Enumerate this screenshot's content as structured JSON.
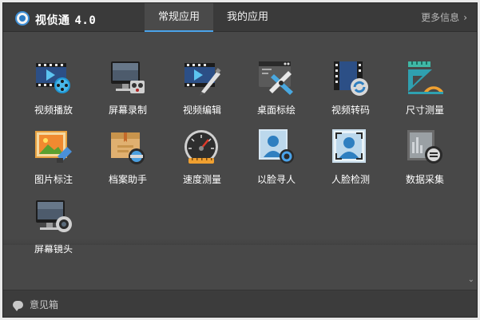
{
  "window": {
    "title": "视侦通",
    "version": "4.0"
  },
  "tabs": [
    {
      "label": "常规应用",
      "active": true
    },
    {
      "label": "我的应用",
      "active": false
    }
  ],
  "more": {
    "label": "更多信息",
    "icon": "chevron-right-icon"
  },
  "apps": [
    {
      "label": "视频播放",
      "icon": "video-play-icon"
    },
    {
      "label": "屏幕录制",
      "icon": "screen-record-icon"
    },
    {
      "label": "视频编辑",
      "icon": "video-edit-icon"
    },
    {
      "label": "桌面标绘",
      "icon": "desktop-draw-icon"
    },
    {
      "label": "视频转码",
      "icon": "video-transcode-icon"
    },
    {
      "label": "尺寸测量",
      "icon": "size-measure-icon"
    },
    {
      "label": "图片标注",
      "icon": "image-annotate-icon"
    },
    {
      "label": "档案助手",
      "icon": "archive-assistant-icon"
    },
    {
      "label": "速度测量",
      "icon": "speed-measure-icon"
    },
    {
      "label": "以脸寻人",
      "icon": "face-search-icon"
    },
    {
      "label": "人脸检测",
      "icon": "face-detect-icon"
    },
    {
      "label": "数据采集",
      "icon": "data-collect-icon"
    },
    {
      "label": "屏幕镜头",
      "icon": "screen-camera-icon"
    }
  ],
  "footer": {
    "feedback_label": "意见箱",
    "icon": "speech-bubble-icon"
  },
  "colors": {
    "tab_underline": "#4aa3ea",
    "background": "#484848",
    "titlebar": "#3a3a3a"
  }
}
